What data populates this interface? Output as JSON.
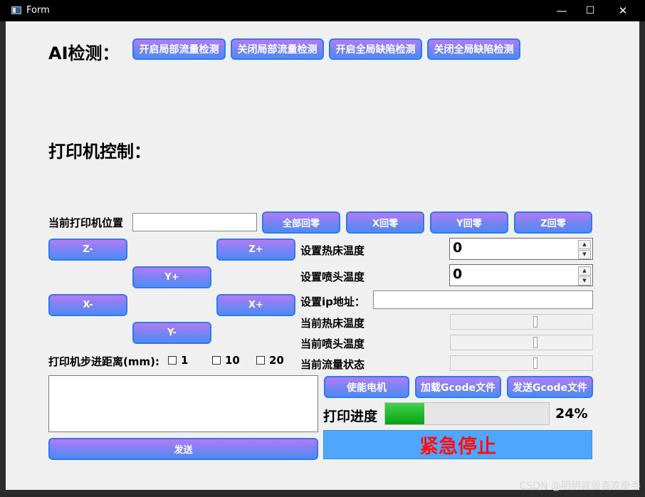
{
  "window": {
    "title": "Form",
    "minimize": "—",
    "maximize": "☐",
    "close": "✕"
  },
  "ai": {
    "heading": "AI检测：",
    "buttons": [
      "开启局部流量检测",
      "关闭局部流量检测",
      "开启全局缺陷检测",
      "关闭全局缺陷检测"
    ]
  },
  "printer": {
    "heading": "打印机控制：",
    "position_label": "当前打印机位置",
    "position_value": "",
    "home_buttons": [
      "全部回零",
      "X回零",
      "Y回零",
      "Z回零"
    ],
    "jog": {
      "z_minus": "Z-",
      "z_plus": "Z+",
      "y_plus": "Y+",
      "x_minus": "X-",
      "x_plus": "X+",
      "y_minus": "Y-"
    },
    "step_label": "打印机步进距离(mm):",
    "steps": [
      "1",
      "10",
      "20"
    ],
    "send_value": "",
    "send_button": "发送"
  },
  "settings": {
    "bed_temp_label": "设置热床温度",
    "bed_temp_value": "0",
    "nozzle_temp_label": "设置喷头温度",
    "nozzle_temp_value": "0",
    "ip_label": "设置ip地址：",
    "ip_value": "",
    "current_bed_label": "当前热床温度",
    "current_nozzle_label": "当前喷头温度",
    "current_flow_label": "当前流量状态"
  },
  "actions": {
    "enable_motor": "使能电机",
    "load_gcode": "加载Gcode文件",
    "send_gcode": "发送Gcode文件"
  },
  "progress": {
    "label": "打印进度",
    "value": 24,
    "text": "24%"
  },
  "estop": "紧急停止",
  "watermark": "CSDN @明明就很喜欢牵手",
  "colors": {
    "accent": "#2b7bf0",
    "estop_bg": "#4fa6ff",
    "estop_text": "#ff1010",
    "progress": "#07a313"
  }
}
